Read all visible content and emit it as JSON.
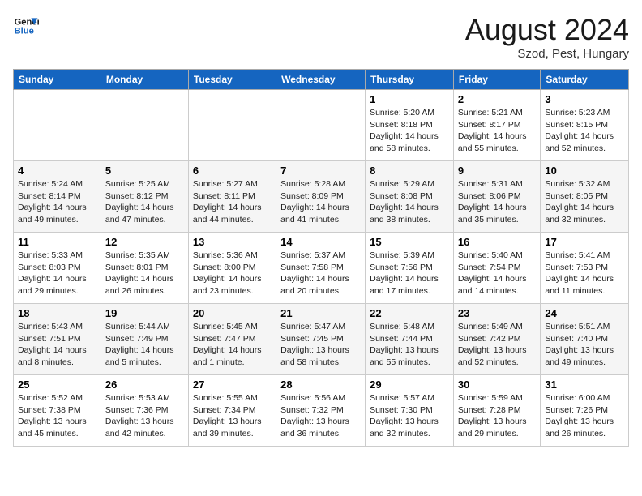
{
  "header": {
    "logo_general": "General",
    "logo_blue": "Blue",
    "month_year": "August 2024",
    "location": "Szod, Pest, Hungary"
  },
  "days_of_week": [
    "Sunday",
    "Monday",
    "Tuesday",
    "Wednesday",
    "Thursday",
    "Friday",
    "Saturday"
  ],
  "weeks": [
    [
      {
        "day": "",
        "info": ""
      },
      {
        "day": "",
        "info": ""
      },
      {
        "day": "",
        "info": ""
      },
      {
        "day": "",
        "info": ""
      },
      {
        "day": "1",
        "info": "Sunrise: 5:20 AM\nSunset: 8:18 PM\nDaylight: 14 hours\nand 58 minutes."
      },
      {
        "day": "2",
        "info": "Sunrise: 5:21 AM\nSunset: 8:17 PM\nDaylight: 14 hours\nand 55 minutes."
      },
      {
        "day": "3",
        "info": "Sunrise: 5:23 AM\nSunset: 8:15 PM\nDaylight: 14 hours\nand 52 minutes."
      }
    ],
    [
      {
        "day": "4",
        "info": "Sunrise: 5:24 AM\nSunset: 8:14 PM\nDaylight: 14 hours\nand 49 minutes."
      },
      {
        "day": "5",
        "info": "Sunrise: 5:25 AM\nSunset: 8:12 PM\nDaylight: 14 hours\nand 47 minutes."
      },
      {
        "day": "6",
        "info": "Sunrise: 5:27 AM\nSunset: 8:11 PM\nDaylight: 14 hours\nand 44 minutes."
      },
      {
        "day": "7",
        "info": "Sunrise: 5:28 AM\nSunset: 8:09 PM\nDaylight: 14 hours\nand 41 minutes."
      },
      {
        "day": "8",
        "info": "Sunrise: 5:29 AM\nSunset: 8:08 PM\nDaylight: 14 hours\nand 38 minutes."
      },
      {
        "day": "9",
        "info": "Sunrise: 5:31 AM\nSunset: 8:06 PM\nDaylight: 14 hours\nand 35 minutes."
      },
      {
        "day": "10",
        "info": "Sunrise: 5:32 AM\nSunset: 8:05 PM\nDaylight: 14 hours\nand 32 minutes."
      }
    ],
    [
      {
        "day": "11",
        "info": "Sunrise: 5:33 AM\nSunset: 8:03 PM\nDaylight: 14 hours\nand 29 minutes."
      },
      {
        "day": "12",
        "info": "Sunrise: 5:35 AM\nSunset: 8:01 PM\nDaylight: 14 hours\nand 26 minutes."
      },
      {
        "day": "13",
        "info": "Sunrise: 5:36 AM\nSunset: 8:00 PM\nDaylight: 14 hours\nand 23 minutes."
      },
      {
        "day": "14",
        "info": "Sunrise: 5:37 AM\nSunset: 7:58 PM\nDaylight: 14 hours\nand 20 minutes."
      },
      {
        "day": "15",
        "info": "Sunrise: 5:39 AM\nSunset: 7:56 PM\nDaylight: 14 hours\nand 17 minutes."
      },
      {
        "day": "16",
        "info": "Sunrise: 5:40 AM\nSunset: 7:54 PM\nDaylight: 14 hours\nand 14 minutes."
      },
      {
        "day": "17",
        "info": "Sunrise: 5:41 AM\nSunset: 7:53 PM\nDaylight: 14 hours\nand 11 minutes."
      }
    ],
    [
      {
        "day": "18",
        "info": "Sunrise: 5:43 AM\nSunset: 7:51 PM\nDaylight: 14 hours\nand 8 minutes."
      },
      {
        "day": "19",
        "info": "Sunrise: 5:44 AM\nSunset: 7:49 PM\nDaylight: 14 hours\nand 5 minutes."
      },
      {
        "day": "20",
        "info": "Sunrise: 5:45 AM\nSunset: 7:47 PM\nDaylight: 14 hours\nand 1 minute."
      },
      {
        "day": "21",
        "info": "Sunrise: 5:47 AM\nSunset: 7:45 PM\nDaylight: 13 hours\nand 58 minutes."
      },
      {
        "day": "22",
        "info": "Sunrise: 5:48 AM\nSunset: 7:44 PM\nDaylight: 13 hours\nand 55 minutes."
      },
      {
        "day": "23",
        "info": "Sunrise: 5:49 AM\nSunset: 7:42 PM\nDaylight: 13 hours\nand 52 minutes."
      },
      {
        "day": "24",
        "info": "Sunrise: 5:51 AM\nSunset: 7:40 PM\nDaylight: 13 hours\nand 49 minutes."
      }
    ],
    [
      {
        "day": "25",
        "info": "Sunrise: 5:52 AM\nSunset: 7:38 PM\nDaylight: 13 hours\nand 45 minutes."
      },
      {
        "day": "26",
        "info": "Sunrise: 5:53 AM\nSunset: 7:36 PM\nDaylight: 13 hours\nand 42 minutes."
      },
      {
        "day": "27",
        "info": "Sunrise: 5:55 AM\nSunset: 7:34 PM\nDaylight: 13 hours\nand 39 minutes."
      },
      {
        "day": "28",
        "info": "Sunrise: 5:56 AM\nSunset: 7:32 PM\nDaylight: 13 hours\nand 36 minutes."
      },
      {
        "day": "29",
        "info": "Sunrise: 5:57 AM\nSunset: 7:30 PM\nDaylight: 13 hours\nand 32 minutes."
      },
      {
        "day": "30",
        "info": "Sunrise: 5:59 AM\nSunset: 7:28 PM\nDaylight: 13 hours\nand 29 minutes."
      },
      {
        "day": "31",
        "info": "Sunrise: 6:00 AM\nSunset: 7:26 PM\nDaylight: 13 hours\nand 26 minutes."
      }
    ]
  ]
}
